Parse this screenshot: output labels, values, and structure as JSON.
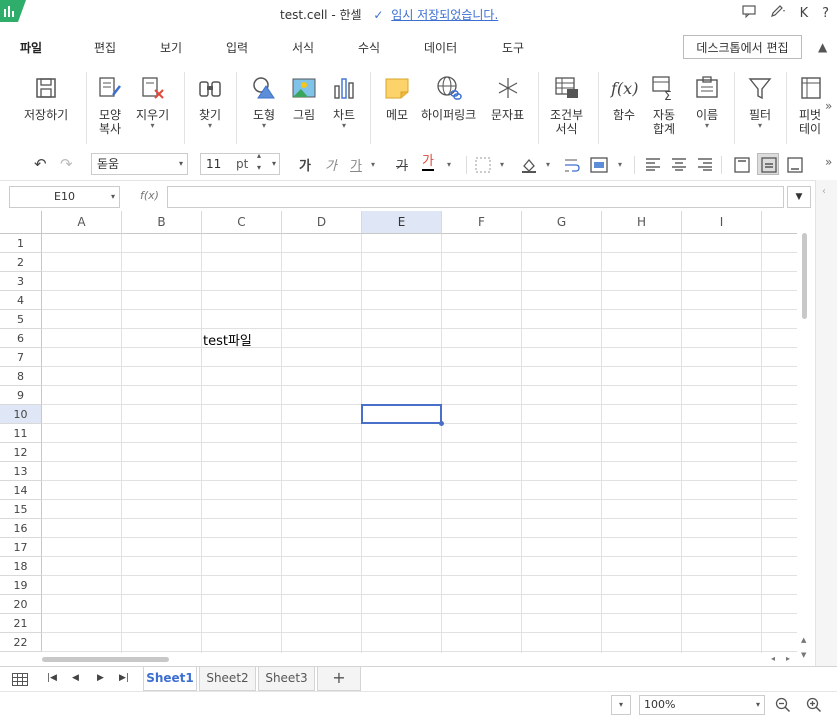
{
  "titlebar": {
    "filename": "test.cell - 한셀",
    "save_status": "임시 저장되었습니다.",
    "user_initial": "K",
    "help": "?"
  },
  "menu": {
    "tabs": [
      "파일",
      "편집",
      "보기",
      "입력",
      "서식",
      "수식",
      "데이터",
      "도구"
    ],
    "desktop_edit": "데스크톱에서 편집"
  },
  "ribbon": {
    "save": "저장하기",
    "format_copy_1": "모양",
    "format_copy_2": "복사",
    "clear": "지우기",
    "find": "찾기",
    "shape": "도형",
    "picture": "그림",
    "chart": "차트",
    "memo": "메모",
    "hyperlink": "하이퍼링크",
    "symbol": "문자표",
    "cond_1": "조건부",
    "cond_2": "서식",
    "function": "함수",
    "autosum_1": "자동",
    "autosum_2": "합계",
    "name": "이름",
    "filter": "필터",
    "pivot_1": "피벗",
    "pivot_2": "테이"
  },
  "format": {
    "font": "돋움",
    "size": "11",
    "unit": "pt",
    "bold": "가",
    "italic": "가",
    "underline": "가",
    "strike": "가",
    "color": "가"
  },
  "formula": {
    "cell_ref": "E10",
    "fx": "f(x)",
    "value": ""
  },
  "grid": {
    "columns": [
      "A",
      "B",
      "C",
      "D",
      "E",
      "F",
      "G",
      "H",
      "I"
    ],
    "rows": [
      "1",
      "2",
      "3",
      "4",
      "5",
      "6",
      "7",
      "8",
      "9",
      "10",
      "11",
      "12",
      "13",
      "14",
      "15",
      "16",
      "17",
      "18",
      "19",
      "20",
      "21",
      "22"
    ],
    "selected": "E10",
    "cell_c6": "test파일"
  },
  "sheets": {
    "tabs": [
      "Sheet1",
      "Sheet2",
      "Sheet3"
    ],
    "active": "Sheet1",
    "add": "+"
  },
  "status": {
    "zoom": "100%"
  }
}
